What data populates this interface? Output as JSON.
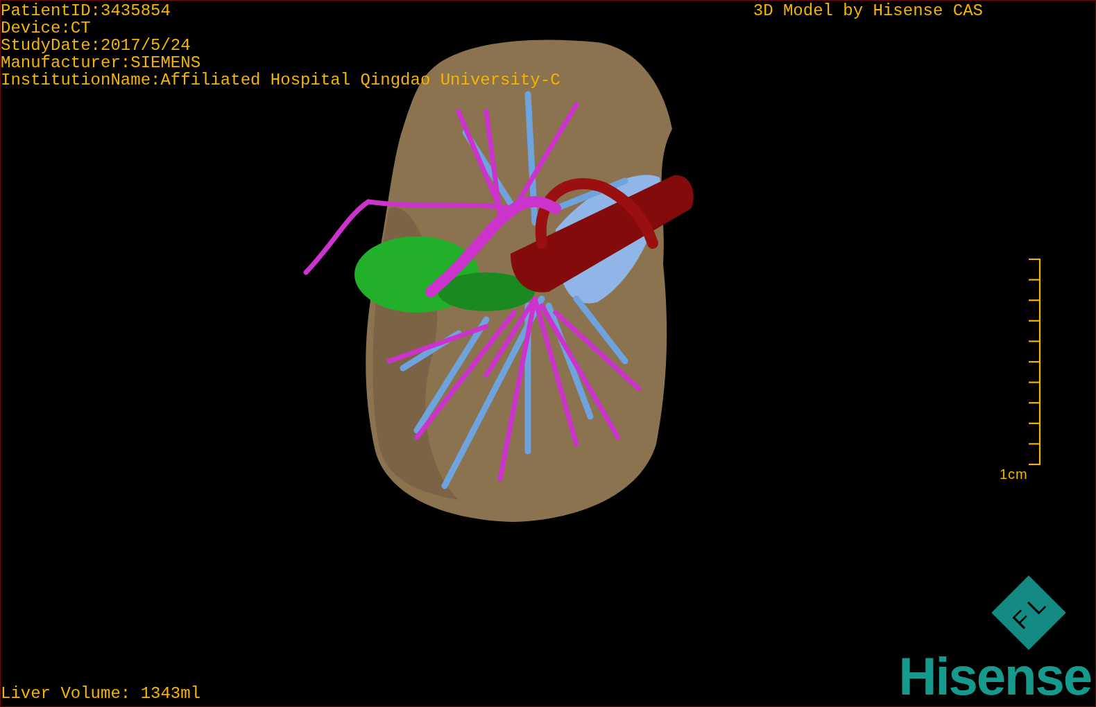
{
  "patient_info": [
    "PatientID:3435854",
    "Device:CT",
    "StudyDate:2017/5/24",
    "Manufacturer:SIEMENS",
    "InstitutionName:Affiliated Hospital Qingdao University-C"
  ],
  "credit": "3D Model by Hisense CAS",
  "scale_bar": {
    "label": "1cm"
  },
  "liver_volume": "Liver Volume: 1343ml",
  "logo": {
    "badge": "F L",
    "name": "Hisense"
  }
}
